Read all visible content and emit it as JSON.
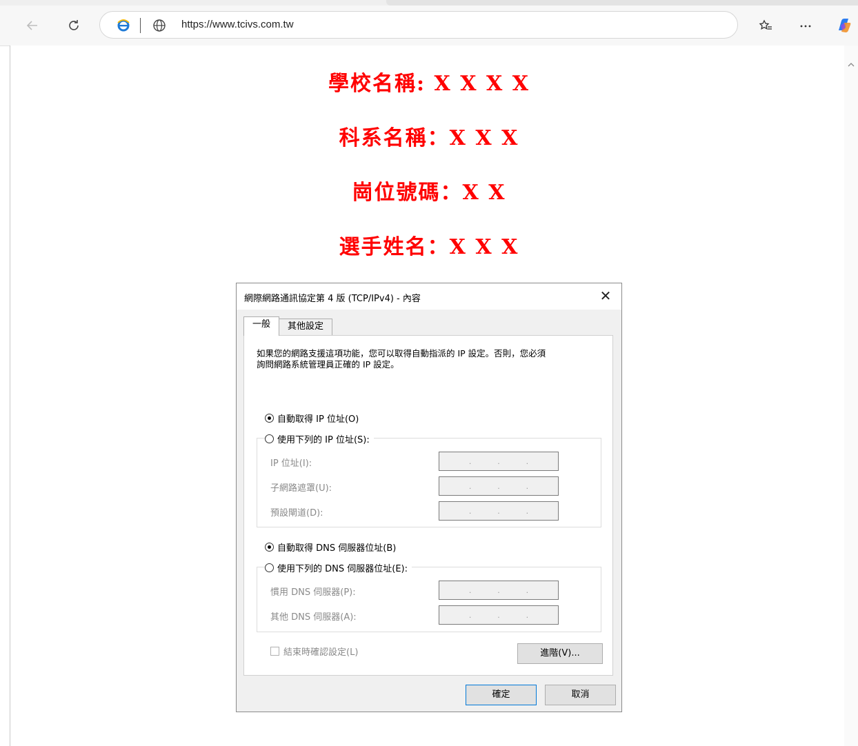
{
  "browser": {
    "url": "https://www.tcivs.com.tw"
  },
  "page": {
    "school_line": "學校名稱: X X X X",
    "department_line": "科系名稱：X X X",
    "station_line": "崗位號碼：X X",
    "player_line": "選手姓名：X X X"
  },
  "dialog": {
    "title": "網際網路通訊協定第 4 版 (TCP/IPv4) - 內容",
    "tabs": [
      "一般",
      "其他設定"
    ],
    "description_line1": "如果您的網路支援這項功能，您可以取得自動指派的 IP 設定。否則，您必須",
    "description_line2": "詢問網路系統管理員正確的 IP 設定。",
    "radio_auto_ip": "自動取得 IP 位址(O)",
    "radio_manual_ip": "使用下列的 IP 位址(S):",
    "label_ip": "IP 位址(I):",
    "label_subnet": "子網路遮罩(U):",
    "label_gateway": "預設閘道(D):",
    "radio_auto_dns": "自動取得 DNS 伺服器位址(B)",
    "radio_manual_dns": "使用下列的 DNS 伺服器位址(E):",
    "label_pref_dns": "慣用 DNS 伺服器(P):",
    "label_alt_dns": "其他 DNS 伺服器(A):",
    "ip_dot": ".",
    "checkbox_validate": "結束時確認設定(L)",
    "advanced_button": "進階(V)...",
    "ok_button": "確定",
    "cancel_button": "取消",
    "close_glyph": "✕"
  },
  "icons": {
    "back": "arrow-left-icon",
    "refresh": "refresh-icon",
    "site": "ie-icon",
    "globe": "globe-icon",
    "favorites": "favorites-icon",
    "more": "more-icon",
    "copilot": "copilot-icon"
  }
}
